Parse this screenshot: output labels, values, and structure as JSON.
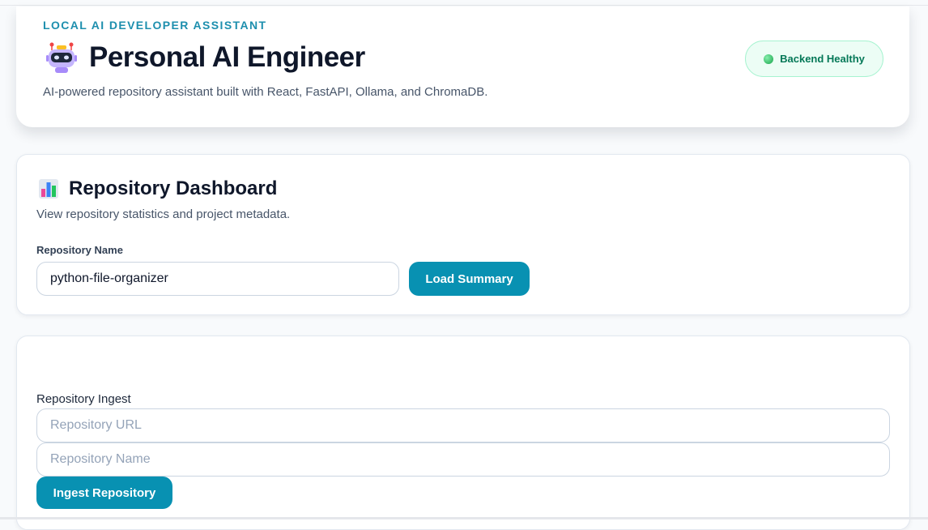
{
  "header": {
    "eyebrow": "LOCAL AI DEVELOPER ASSISTANT",
    "title": "Personal AI Engineer",
    "subtitle": "AI-powered repository assistant built with React, FastAPI, Ollama, and ChromaDB.",
    "icon": "robot-icon",
    "status": {
      "label": "Backend Healthy",
      "color": "#047857",
      "indicator_color": "#22c55e"
    }
  },
  "dashboard": {
    "icon": "bar-chart-icon",
    "title": "Repository Dashboard",
    "subtitle": "View repository statistics and project metadata.",
    "repo_name_label": "Repository Name",
    "repo_name_value": "python-file-organizer",
    "load_button_label": "Load Summary"
  },
  "ingest": {
    "label": "Repository Ingest",
    "url_value": "",
    "url_placeholder": "Repository URL",
    "name_value": "",
    "name_placeholder": "Repository Name",
    "button_label": "Ingest Repository"
  },
  "theme": {
    "accent": "#0891b2",
    "eyebrow": "#1d8fae"
  }
}
